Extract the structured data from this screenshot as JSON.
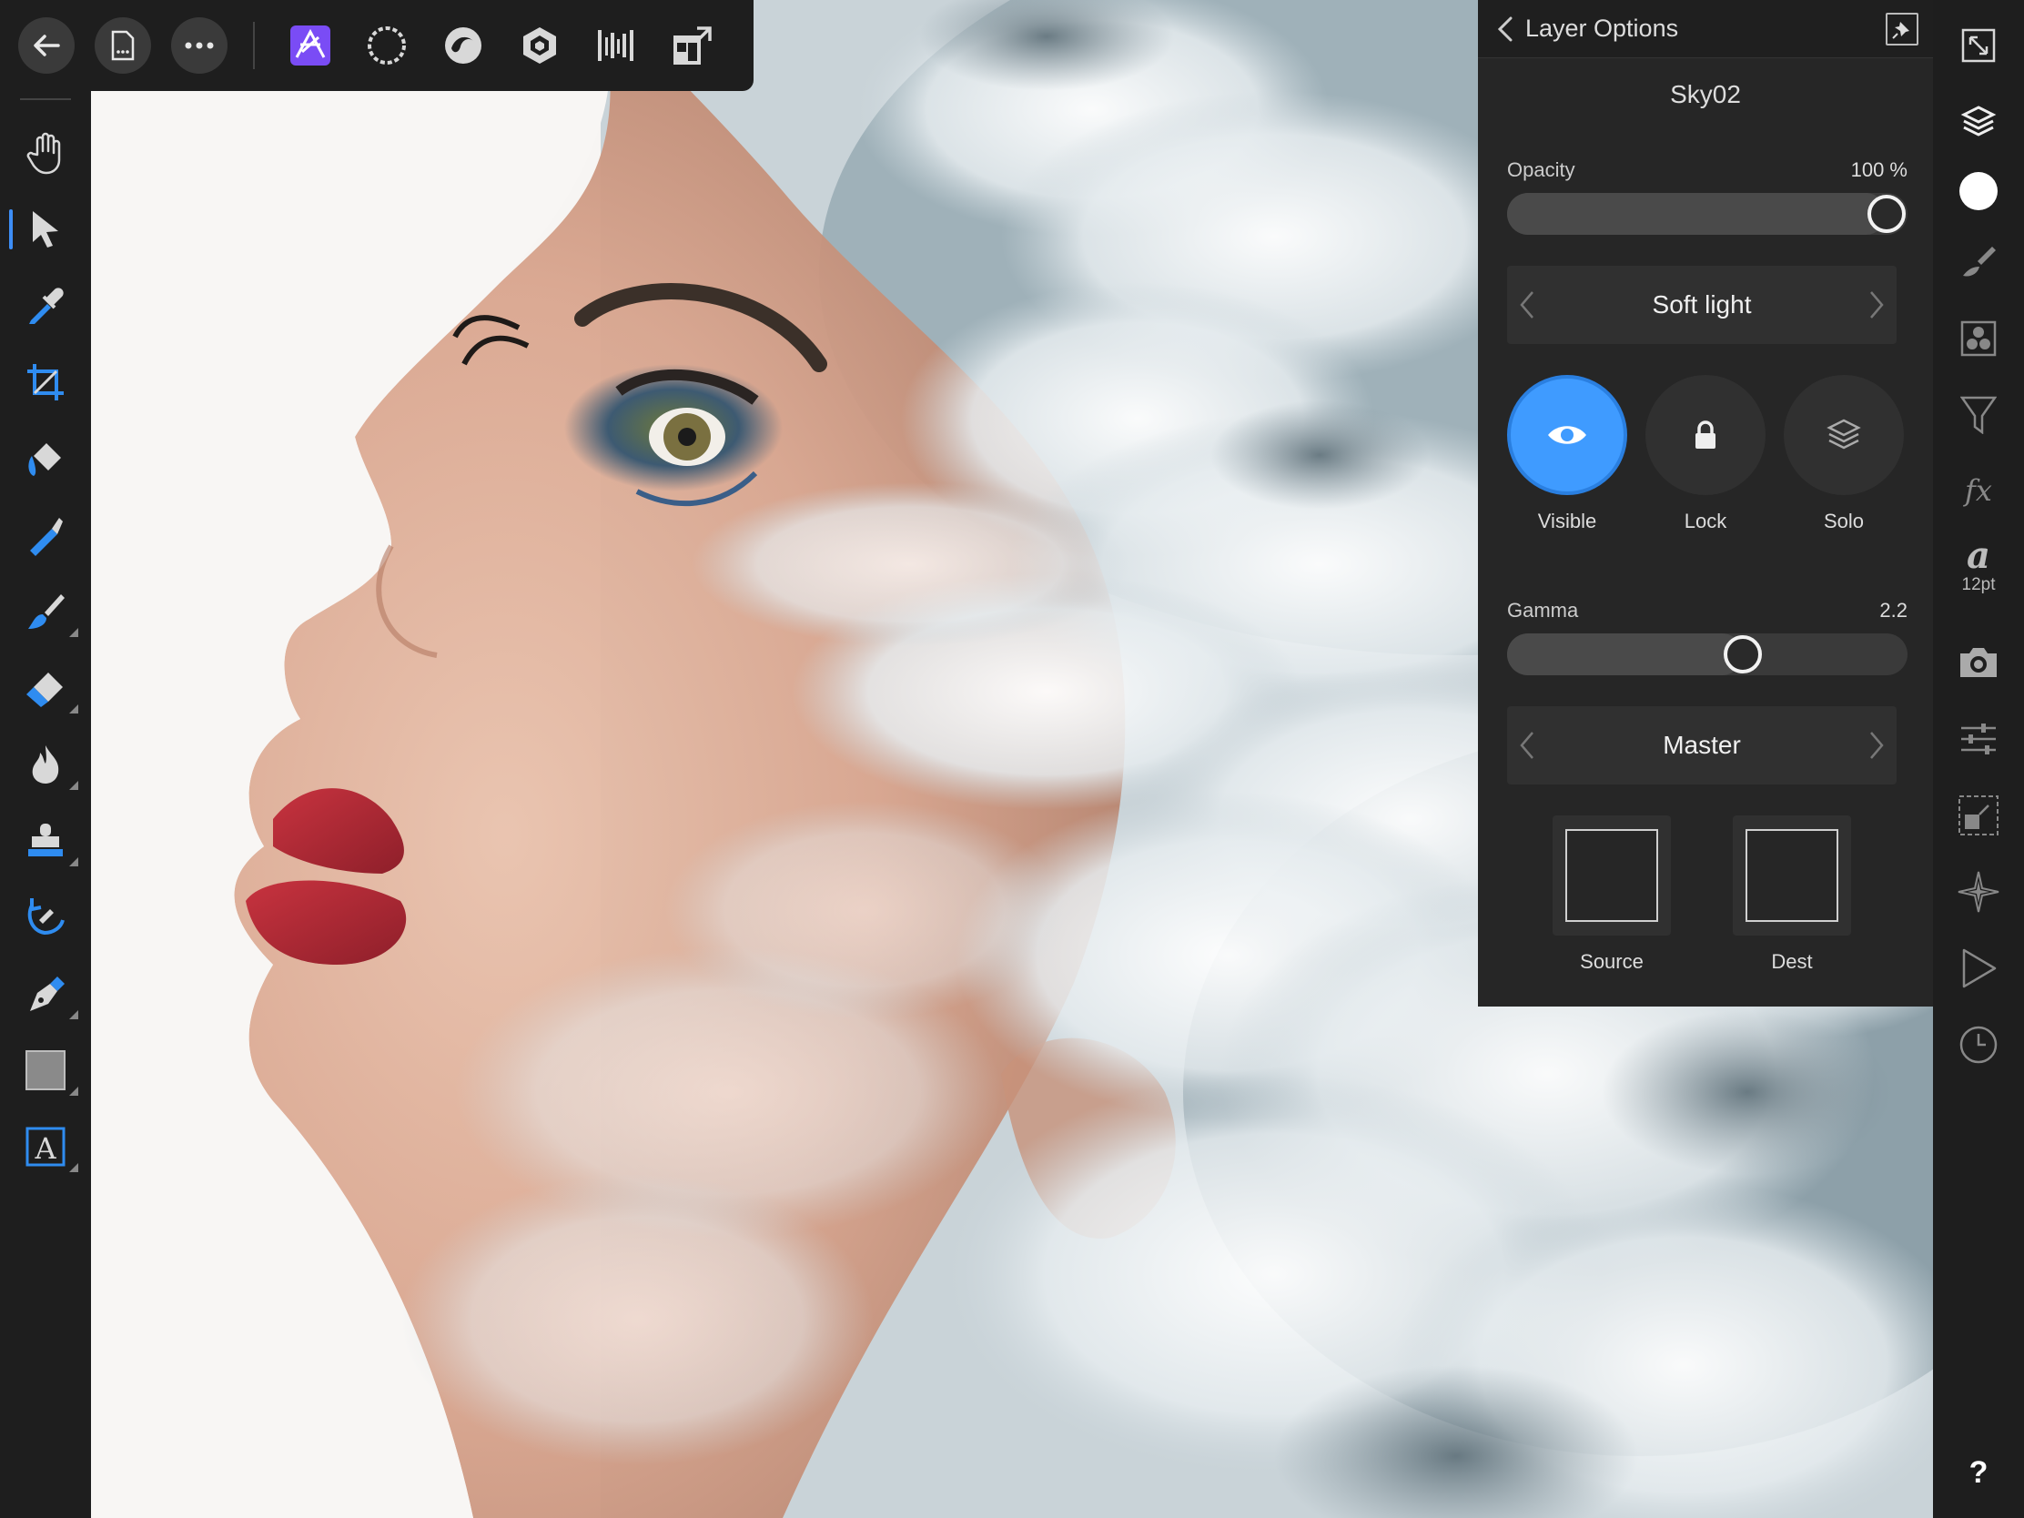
{
  "toolbar": {
    "buttons": [
      {
        "name": "back-arrow-icon"
      },
      {
        "name": "document-icon"
      },
      {
        "name": "more-icon"
      }
    ],
    "personas": [
      {
        "name": "photo-persona-icon",
        "color": "#7a4cf5",
        "active": true
      },
      {
        "name": "selection-persona-icon"
      },
      {
        "name": "liquify-persona-icon"
      },
      {
        "name": "develop-persona-icon"
      },
      {
        "name": "tone-mapping-persona-icon"
      },
      {
        "name": "export-persona-icon"
      }
    ]
  },
  "tools": [
    "view-tool",
    "move-tool",
    "color-picker-tool",
    "crop-tool",
    "flood-fill-tool",
    "selection-brush-tool",
    "paint-brush-tool",
    "erase-brush-tool",
    "burn-brush-tool",
    "clone-brush-tool",
    "undo-brush-tool",
    "pen-tool",
    "rectangle-tool",
    "text-tool"
  ],
  "studio": {
    "text_size": "12pt",
    "help_label": "?"
  },
  "panel": {
    "title": "Layer Options",
    "layer_name": "Sky02",
    "opacity": {
      "label": "Opacity",
      "value": "100 %",
      "fraction": 1.0
    },
    "blend_mode": "Soft light",
    "toggles": [
      {
        "label": "Visible",
        "on": true
      },
      {
        "label": "Lock",
        "on": false
      },
      {
        "label": "Solo",
        "on": false
      }
    ],
    "gamma": {
      "label": "Gamma",
      "value": "2.2",
      "fraction": 0.6
    },
    "channel": "Master",
    "source_label": "Source",
    "dest_label": "Dest"
  },
  "colors": {
    "accent": "#3f9bff",
    "persona_active": "#7a4cf5",
    "ui_bg": "#1e1e1e",
    "panel_bg": "#262626"
  }
}
